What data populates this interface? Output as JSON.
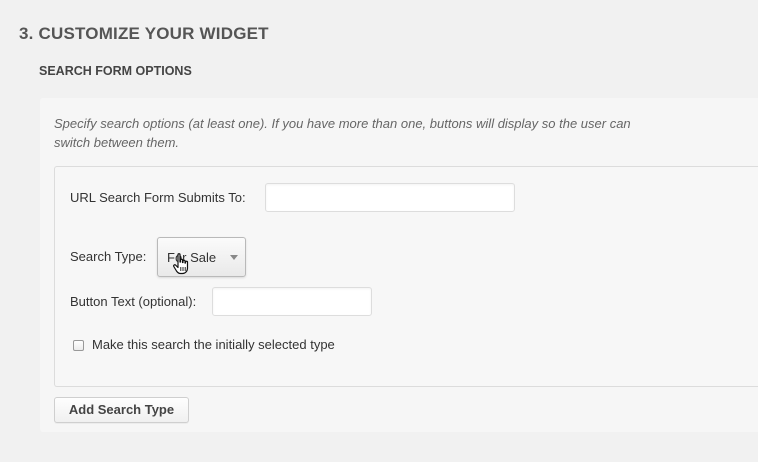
{
  "section": {
    "title": "3. CUSTOMIZE YOUR WIDGET",
    "subtitle": "SEARCH FORM OPTIONS"
  },
  "panel": {
    "description": "Specify search options (at least one). If you have more than one, buttons will display so the user can switch between them.",
    "url_label": "URL Search Form Submits To:",
    "url_value": "",
    "search_type_label": "Search Type:",
    "search_type_value": "For Sale",
    "button_text_label": "Button Text (optional):",
    "button_text_value": "",
    "initial_checkbox_label": "Make this search the initially selected type",
    "initial_checkbox_checked": false,
    "add_button_label": "Add Search Type"
  },
  "icons": {
    "cursor": "hand-pointer-cursor-icon",
    "select_arrow": "chevron-down-icon"
  }
}
